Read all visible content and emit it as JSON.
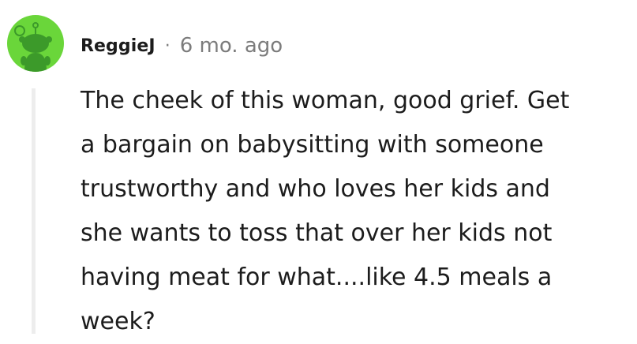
{
  "comment": {
    "author": "ReggieJ",
    "separator": "·",
    "timestamp": "6 mo. ago",
    "avatar_icon": "snoo-avatar-icon",
    "body_lines": [
      "The cheek of this woman, good grief. Get",
      "a bargain on babysitting with someone",
      "trustworthy and who loves her kids and",
      "she wants to toss that over her kids not",
      "having meat for what....like 4.5 meals a",
      "week?"
    ]
  },
  "colors": {
    "avatar_background": "#6ad63a",
    "avatar_snoo": "#3c9a2a",
    "text": "#1c1c1c",
    "muted_text": "#7c7c7c",
    "thread_line": "#ededed"
  }
}
